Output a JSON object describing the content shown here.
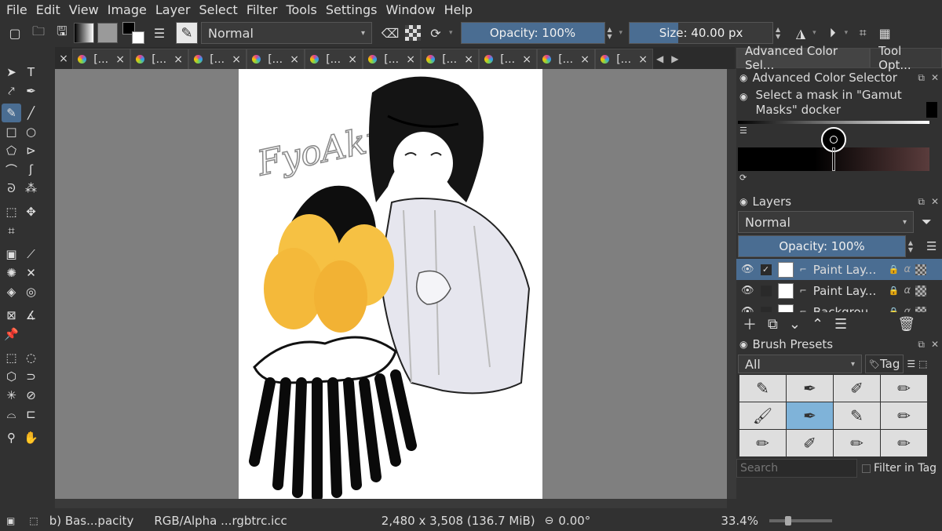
{
  "menu": [
    "File",
    "Edit",
    "View",
    "Image",
    "Layer",
    "Select",
    "Filter",
    "Tools",
    "Settings",
    "Window",
    "Help"
  ],
  "toolbar": {
    "blend_mode": "Normal",
    "opacity_label": "Opacity: 100%",
    "opacity_value": 1.0,
    "size_label": "Size: 40.00 px"
  },
  "tabs": {
    "label": "[...",
    "count": 11,
    "close_glyph": "×"
  },
  "dock": {
    "tab_color": "Advanced Color Sel...",
    "tab_tool": "Tool Opt...",
    "color_selector_title": "Advanced Color Selector",
    "gamut_message": "Select a mask in \"Gamut Masks\" docker",
    "layers_title": "Layers",
    "layers_blend": "Normal",
    "layers_opacity": "Opacity:  100%",
    "layers": [
      {
        "name": "Paint Lay...",
        "visible": true,
        "selected": true
      },
      {
        "name": "Paint Lay...",
        "visible": true,
        "selected": false
      },
      {
        "name": "Backgrou...",
        "visible": true,
        "selected": false
      }
    ],
    "brush_title": "Brush Presets",
    "brush_filter": "All",
    "brush_tag": "Tag",
    "search_placeholder": "Search",
    "filter_in_tag": "Filter in Tag"
  },
  "status": {
    "brush_name": "b) Bas...pacity",
    "color_profile": "RGB/Alpha ...rgbtrc.icc",
    "dimensions": "2,480 x 3,508 (136.7 MiB)",
    "rotation": "0.00°",
    "zoom": "33.4%"
  },
  "canvas_text": "FyoAku",
  "colors": {
    "accent": "#4a6d92",
    "panel": "#313131",
    "canvas_bg": "#7f7f7f"
  }
}
